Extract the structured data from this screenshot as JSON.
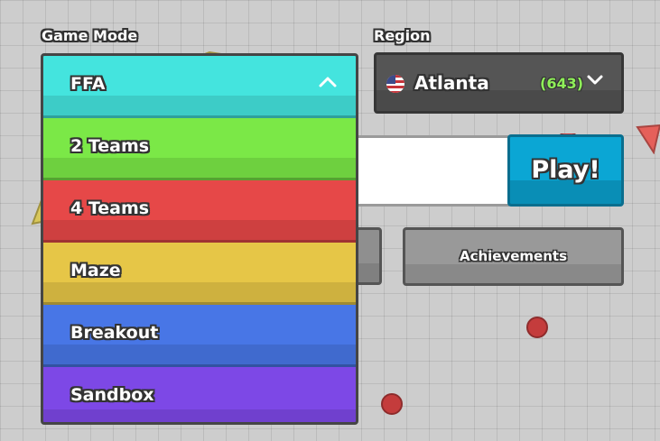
{
  "labels": {
    "game_mode": "Game Mode",
    "region": "Region"
  },
  "game_mode": {
    "options": [
      {
        "label": "FFA",
        "color": "#44e4de"
      },
      {
        "label": "2 Teams",
        "color": "#7be847"
      },
      {
        "label": "4 Teams",
        "color": "#e64848"
      },
      {
        "label": "Maze",
        "color": "#e6c647"
      },
      {
        "label": "Breakout",
        "color": "#4876e6"
      },
      {
        "label": "Sandbox",
        "color": "#7d48e6"
      }
    ],
    "selected": "FFA"
  },
  "region": {
    "name": "Atlanta",
    "player_count": "(643)",
    "flag": "us-flag-icon"
  },
  "play_button": "Play!",
  "achievements_button": "Achievements",
  "colors": {
    "background": "#cdcdcd",
    "play": "#0ba6d4",
    "count": "#8fef59",
    "enemy_dot": "#c43c3c"
  }
}
